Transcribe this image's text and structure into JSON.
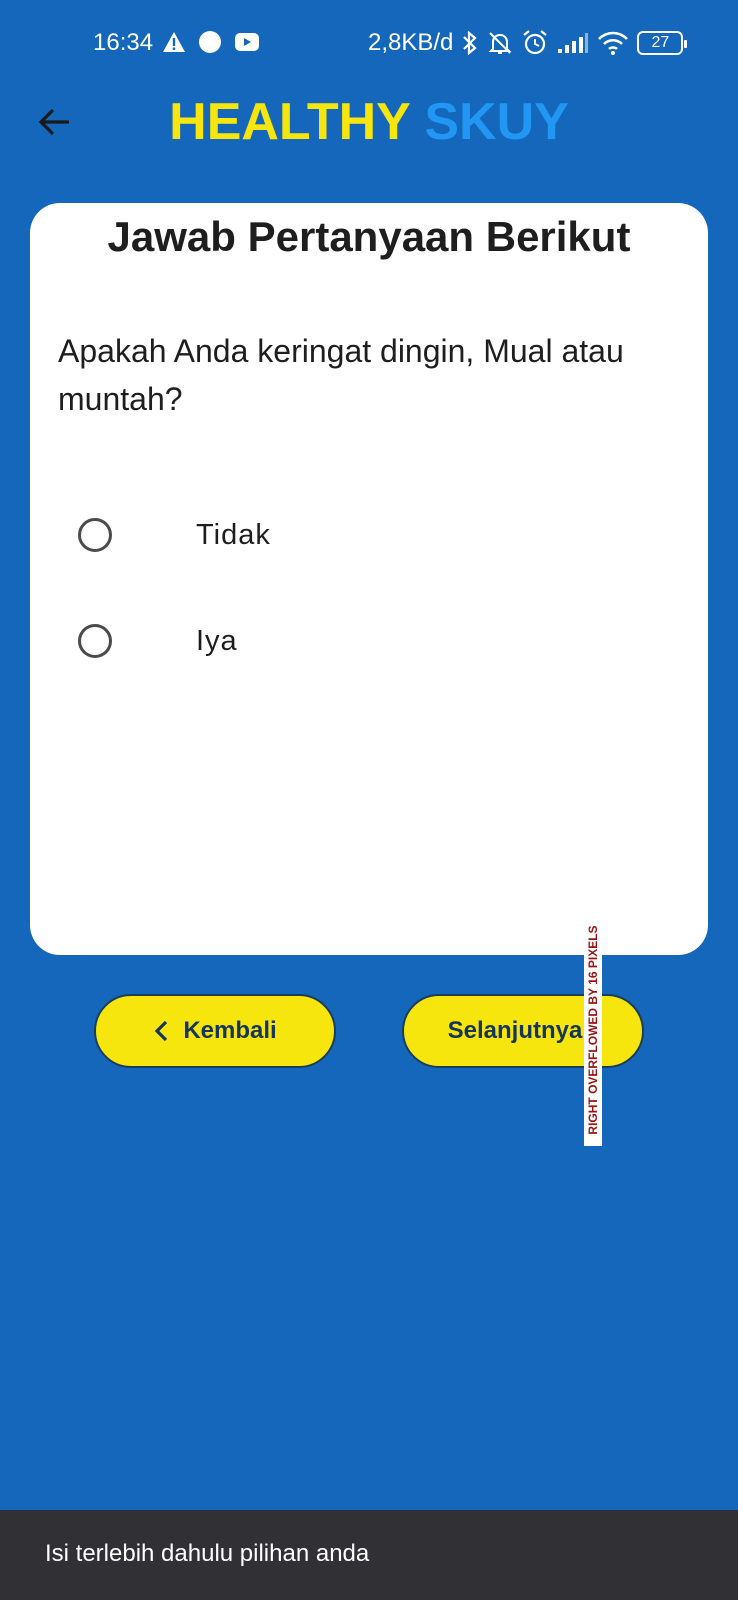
{
  "status_bar": {
    "time": "16:34",
    "left_icons": [
      "warning-icon",
      "circle-icon",
      "youtube-icon"
    ],
    "network_speed": "2,8KB/d",
    "right_icons": [
      "bluetooth-icon",
      "mute-icon",
      "alarm-icon",
      "signal-icon",
      "wifi-icon"
    ],
    "battery": "27"
  },
  "appbar": {
    "back_icon": "arrow-left-icon",
    "title_part1": "HEALTHY",
    "title_part2": "SKUY",
    "colors": {
      "part1": "#F6E60E",
      "part2": "#2196F3"
    }
  },
  "card": {
    "heading": "Jawab Pertanyaan Berikut",
    "question": "Apakah Anda keringat dingin, Mual atau muntah?",
    "options": [
      {
        "label": "Tidak",
        "selected": false
      },
      {
        "label": "Iya",
        "selected": false
      }
    ]
  },
  "buttons": {
    "back_label": "Kembali",
    "next_label": "Selanjutnya"
  },
  "overflow_warning": "RIGHT OVERFLOWED BY 16 PIXELS",
  "snackbar": {
    "message": "Isi terlebih dahulu pilihan anda"
  },
  "theme": {
    "background": "#1467BB",
    "button": "#F6E60E"
  }
}
